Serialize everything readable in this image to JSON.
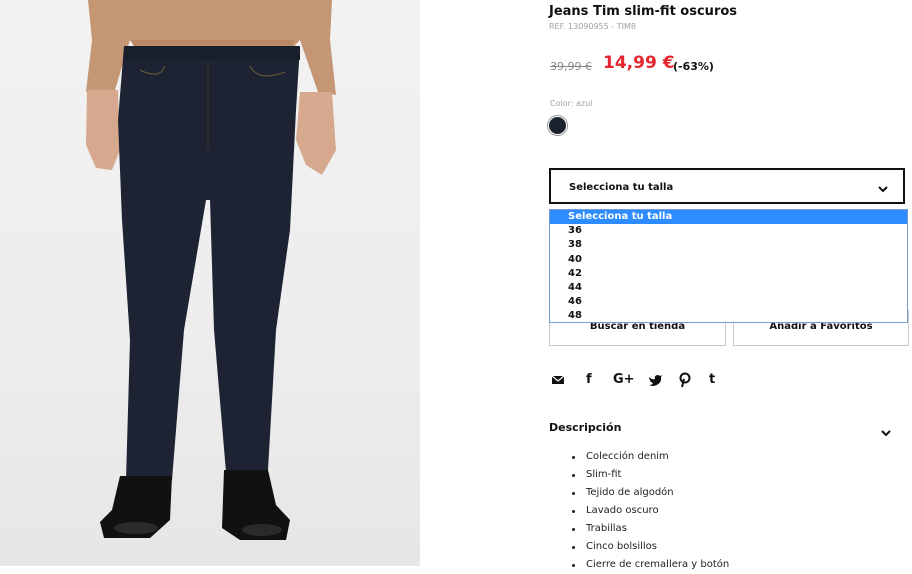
{
  "product": {
    "title": "Jeans Tim slim-fit oscuros",
    "ref": "REF. 13090955 - TIM8",
    "price_old": "39,99 €",
    "price_new": "14,99 €",
    "discount": "(-63%)",
    "color_label": "Color: azul",
    "colors": {
      "swatch": "#1b2230",
      "sale": "#e4262f",
      "dropdown_highlight": "#2d8cff"
    }
  },
  "size_select": {
    "label": "Selecciona tu talla",
    "options": [
      "Selecciona tu talla",
      "36",
      "38",
      "40",
      "42",
      "44",
      "46",
      "48"
    ],
    "selected_index": 0
  },
  "buttons": {
    "store": "Buscar en tienda",
    "favorites": "Añadir a Favoritos"
  },
  "social": {
    "icons": [
      "email-icon",
      "facebook-icon",
      "google-plus-icon",
      "twitter-icon",
      "pinterest-icon",
      "tumblr-icon"
    ],
    "glyphs": {
      "facebook": "f",
      "google": "G+",
      "tumblr": "t"
    }
  },
  "description": {
    "title": "Descripción",
    "items": [
      "Colección denim",
      "Slim-fit",
      "Tejido de algodón",
      "Lavado oscuro",
      "Trabillas",
      "Cinco bolsillos",
      "Cierre de cremallera y botón"
    ]
  }
}
